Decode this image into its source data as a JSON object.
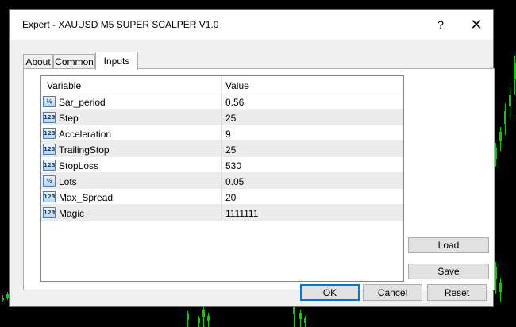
{
  "window": {
    "title": "Expert - XAUUSD M5 SUPER SCALPER V1.0",
    "help_glyph": "?",
    "close_glyph": "✕"
  },
  "tabs": [
    {
      "label": "About",
      "active": false
    },
    {
      "label": "Common",
      "active": false
    },
    {
      "label": "Inputs",
      "active": true
    }
  ],
  "table": {
    "headers": {
      "variable": "Variable",
      "value": "Value"
    },
    "rows": [
      {
        "icon": "double-type-icon",
        "icon_text": "½",
        "variable": "Sar_period",
        "value": "0.56"
      },
      {
        "icon": "integer-type-icon",
        "icon_text": "123",
        "variable": "Step",
        "value": "25"
      },
      {
        "icon": "integer-type-icon",
        "icon_text": "123",
        "variable": "Acceleration",
        "value": "9"
      },
      {
        "icon": "integer-type-icon",
        "icon_text": "123",
        "variable": "TrailingStop",
        "value": "25"
      },
      {
        "icon": "integer-type-icon",
        "icon_text": "123",
        "variable": "StopLoss",
        "value": "530"
      },
      {
        "icon": "double-type-icon",
        "icon_text": "½",
        "variable": "Lots",
        "value": "0.05"
      },
      {
        "icon": "integer-type-icon",
        "icon_text": "123",
        "variable": "Max_Spread",
        "value": "20"
      },
      {
        "icon": "integer-type-icon",
        "icon_text": "123",
        "variable": "Magic",
        "value": "1111111"
      }
    ]
  },
  "side_buttons": {
    "load": "Load",
    "save": "Save"
  },
  "footer": {
    "ok": "OK",
    "cancel": "Cancel",
    "reset": "Reset"
  },
  "colors": {
    "chart_background": "#000000",
    "candle": "#00d100",
    "dialog": "#f0f0f0",
    "ok_border": "#0078d7"
  }
}
